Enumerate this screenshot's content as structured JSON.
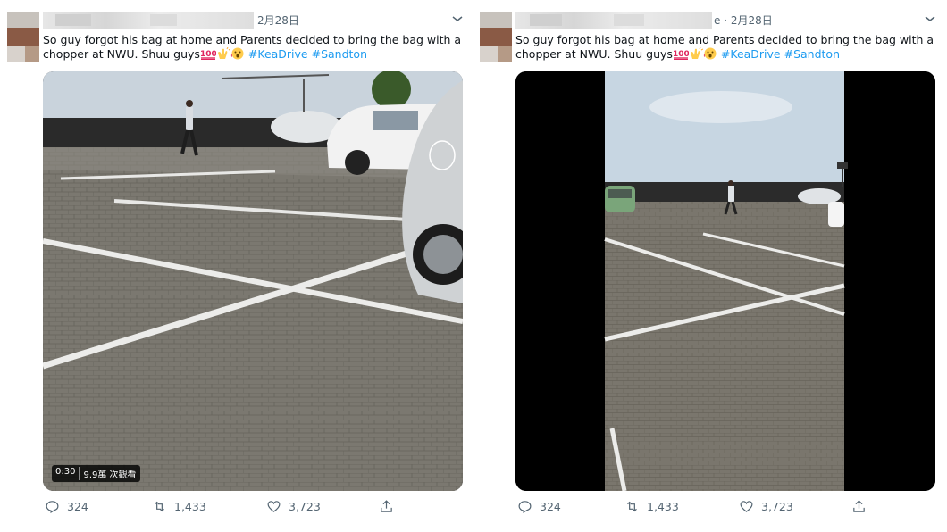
{
  "tweets": [
    {
      "date": "2月28日",
      "text_main": "So guy forgot his bag at home and Parents decided to bring the bag with a chopper at NWU. Shuu guys",
      "hashtags": [
        "#KeaDrive",
        "#Sandton"
      ],
      "emojis": [
        "hundred-points-icon",
        "clapping-hands-icon",
        "astonished-face-icon"
      ],
      "video": {
        "duration": "0:30",
        "views": "9.9萬 次觀看"
      },
      "actions": {
        "replies": "324",
        "retweets": "1,433",
        "likes": "3,723"
      }
    },
    {
      "date": "e · 2月28日",
      "text_main": "So guy forgot his bag at home and Parents decided to bring the bag with a chopper at NWU. Shuu guys",
      "hashtags": [
        "#KeaDrive",
        "#Sandton"
      ],
      "emojis": [
        "hundred-points-icon",
        "clapping-hands-icon",
        "astonished-face-icon"
      ],
      "actions": {
        "replies": "324",
        "retweets": "1,433",
        "likes": "3,723"
      }
    }
  ],
  "colors": {
    "link": "#1d9bf0",
    "muted": "#536471",
    "text": "#0f1419"
  }
}
